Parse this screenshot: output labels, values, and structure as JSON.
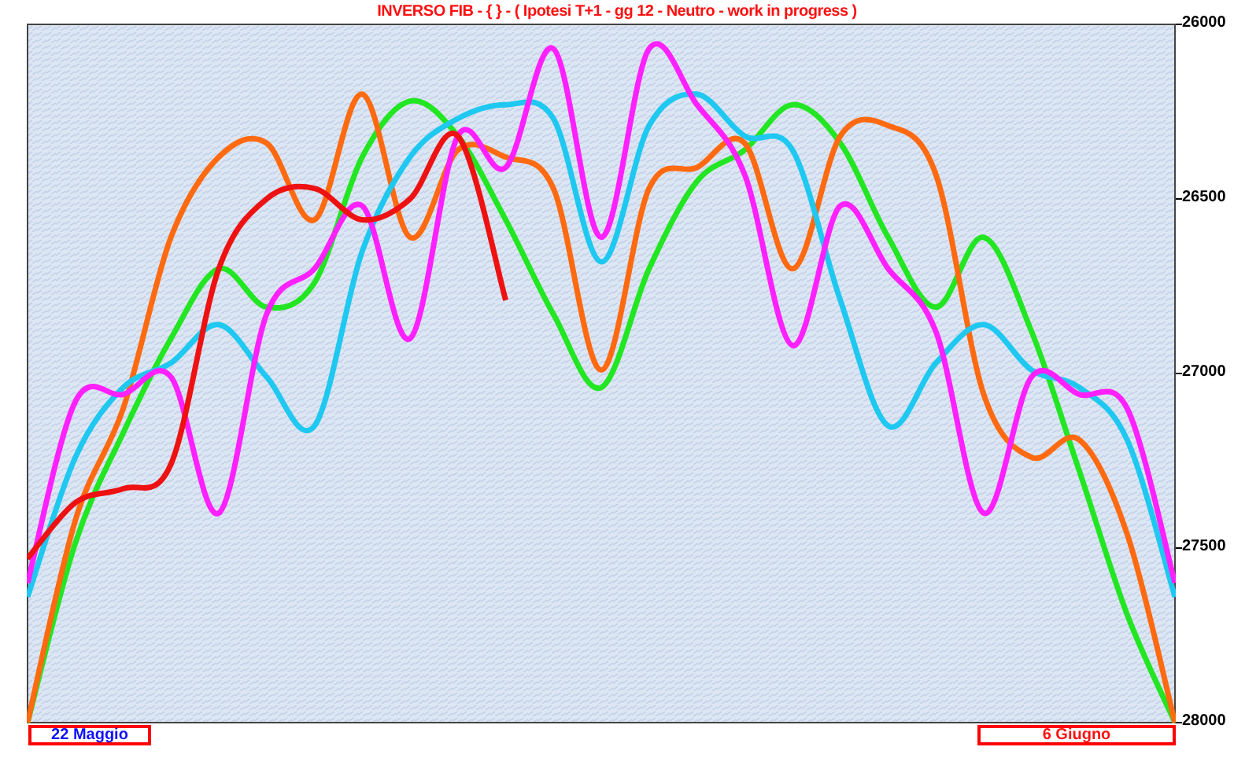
{
  "title": "INVERSO FIB  -  {  } - ( Ipotesi T+1 - gg 12 -  Neutro - work in progress )",
  "chart": {
    "chart_data": {
      "type": "line",
      "ylim": [
        28000,
        26000
      ],
      "yticks": [
        {
          "value": 26000,
          "label": "26000"
        },
        {
          "value": 26500,
          "label": "26500"
        },
        {
          "value": 27000,
          "label": "27000"
        },
        {
          "value": 27500,
          "label": "27500"
        },
        {
          "value": 28000,
          "label": "28000"
        }
      ],
      "series": [
        {
          "color": "#22e622",
          "values": [
            28000,
            27485,
            27170,
            26900,
            26700,
            26810,
            26740,
            26380,
            26220,
            26320,
            26560,
            26830,
            27040,
            26700,
            26450,
            26360,
            26230,
            26340,
            26610,
            26810,
            26610,
            26880,
            27280,
            27690,
            28000
          ]
        },
        {
          "color": "#ff6a10",
          "values": [
            28000,
            27420,
            27100,
            26610,
            26380,
            26340,
            26560,
            26200,
            26610,
            26360,
            26380,
            26470,
            26990,
            26470,
            26410,
            26340,
            26700,
            26320,
            26290,
            26430,
            27060,
            27240,
            27190,
            27460,
            28000
          ]
        },
        {
          "color": "#1ec8f0",
          "values": [
            27640,
            27240,
            27040,
            26970,
            26860,
            27010,
            27150,
            26650,
            26380,
            26270,
            26230,
            26270,
            26680,
            26290,
            26200,
            26320,
            26360,
            26790,
            27150,
            26970,
            26860,
            26990,
            27040,
            27190,
            27640
          ]
        },
        {
          "color": "#ff20ff",
          "values": [
            27600,
            27080,
            27060,
            27010,
            27400,
            26830,
            26700,
            26520,
            26900,
            26320,
            26410,
            26070,
            26610,
            26070,
            26230,
            26430,
            26920,
            26520,
            26700,
            26880,
            27400,
            27010,
            27060,
            27100,
            27600
          ]
        },
        {
          "color": "#ee1111",
          "values": [
            27530,
            27370,
            27330,
            27260,
            26700,
            26500,
            26470,
            26560,
            26500,
            26320,
            26790,
            null,
            null,
            null,
            null,
            null,
            null,
            null,
            null,
            null,
            null,
            null,
            null,
            null,
            null
          ]
        }
      ]
    }
  },
  "date_labels": [
    {
      "text": "22  Maggio",
      "color": "#1010ff"
    },
    {
      "text": "6  Giugno",
      "color": "#ff1010"
    }
  ]
}
